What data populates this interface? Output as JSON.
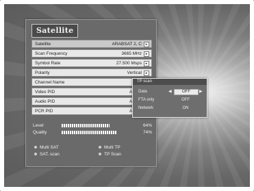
{
  "menu": {
    "title": "Satellite",
    "rows": [
      {
        "label": "Satellite",
        "value": "ARABSAT 2, C"
      },
      {
        "label": "Scan Frequency",
        "value": "3665 MHz"
      },
      {
        "label": "Symbol Rate",
        "value": "27.500 Msps"
      },
      {
        "label": "Polarity",
        "value": "Vertical"
      },
      {
        "label": "Channel Name",
        "value": ""
      },
      {
        "label": "Video PID",
        "value": "AUTO"
      },
      {
        "label": "Audio PID",
        "value": "AUTO"
      },
      {
        "label": "PCR PID",
        "value": "AUTO"
      }
    ],
    "signal": [
      {
        "label": "Level",
        "percent": "64%",
        "fraction": 0.64
      },
      {
        "label": "Quality",
        "percent": "74%",
        "fraction": 0.74
      }
    ],
    "options": [
      {
        "label": "Multi SAT"
      },
      {
        "label": "Multi TP"
      },
      {
        "label": "SAT. scan"
      },
      {
        "label": "TP Scan"
      }
    ]
  },
  "tp_scan": {
    "title": "TP scan",
    "rows": [
      {
        "label": "Data",
        "value": "OFF",
        "selected": true
      },
      {
        "label": "FTA only",
        "value": "OFF"
      },
      {
        "label": "Network",
        "value": "ON"
      }
    ]
  },
  "colors": {
    "panel": "#6a6a6a",
    "row_bg": "#e8e8e8",
    "popup": "#6e6e6e"
  },
  "icons": {
    "row_arrow": "arrow-right-icon",
    "left_arrow": "arrow-left-icon"
  }
}
